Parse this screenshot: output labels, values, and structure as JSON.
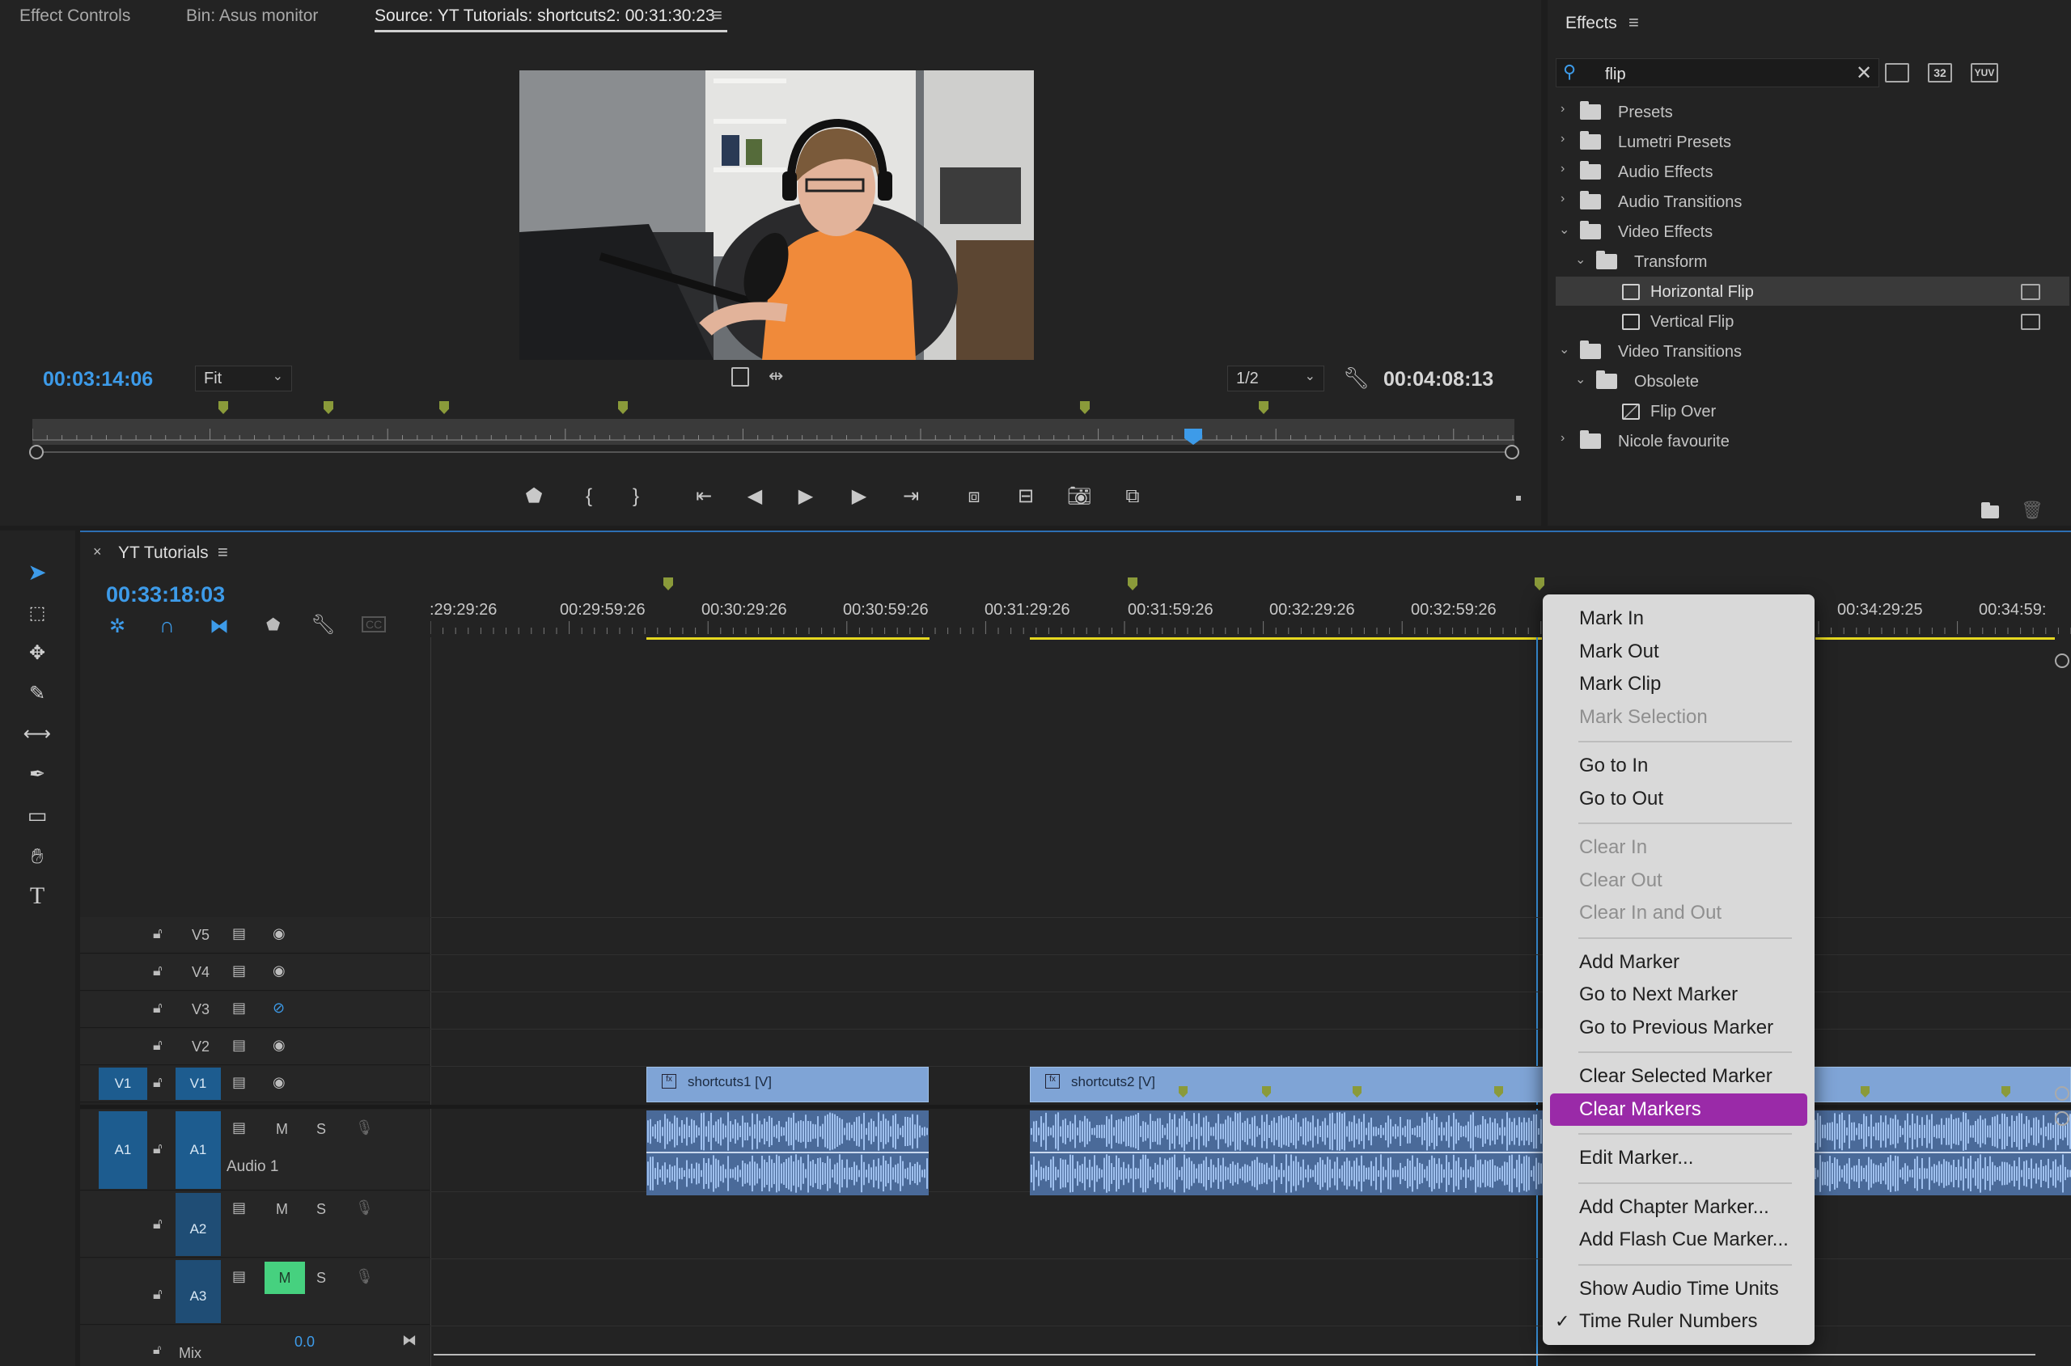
{
  "source_panel": {
    "tabs": [
      "Effect Controls",
      "Bin: Asus monitor",
      "Source: YT Tutorials: shortcuts2: 00:31:30:23"
    ],
    "current_time": "00:03:14:06",
    "zoom": "Fit",
    "resolution": "1/2",
    "duration": "00:04:08:13"
  },
  "effects_panel": {
    "title": "Effects",
    "search": {
      "value": "flip"
    },
    "view_buttons": [
      "32"
    ],
    "tree": [
      {
        "label": "Presets",
        "indent": 0,
        "type": "folder",
        "expanded": false
      },
      {
        "label": "Lumetri Presets",
        "indent": 0,
        "type": "folder",
        "expanded": false
      },
      {
        "label": "Audio Effects",
        "indent": 0,
        "type": "folder",
        "expanded": false
      },
      {
        "label": "Audio Transitions",
        "indent": 0,
        "type": "folder",
        "expanded": false
      },
      {
        "label": "Video Effects",
        "indent": 0,
        "type": "folder",
        "expanded": true
      },
      {
        "label": "Transform",
        "indent": 1,
        "type": "folder",
        "expanded": true
      },
      {
        "label": "Horizontal Flip",
        "indent": 2,
        "type": "effect",
        "selected": true
      },
      {
        "label": "Vertical Flip",
        "indent": 2,
        "type": "effect"
      },
      {
        "label": "Video Transitions",
        "indent": 0,
        "type": "folder",
        "expanded": true
      },
      {
        "label": "Obsolete",
        "indent": 1,
        "type": "folder",
        "expanded": true
      },
      {
        "label": "Flip Over",
        "indent": 2,
        "type": "transition"
      },
      {
        "label": "Nicole favourite",
        "indent": 0,
        "type": "folder",
        "expanded": false
      }
    ]
  },
  "timeline": {
    "sequence_name": "YT Tutorials",
    "close": "×",
    "current_time": "00:33:18:03",
    "ruler_labels": [
      ":29:29:26",
      "00:29:59:26",
      "00:30:29:26",
      "00:30:59:26",
      "00:31:29:26",
      "00:31:59:26",
      "00:32:29:26",
      "00:32:59:26",
      "00:34:29:25",
      "00:34:59:"
    ],
    "tracks": {
      "video": [
        "V5",
        "V4",
        "V3",
        "V2",
        "V1"
      ],
      "audio": [
        "A1",
        "A2",
        "A3"
      ],
      "source_v": "V1",
      "source_a": "A1",
      "audio1_name": "Audio 1",
      "mute": "M",
      "solo": "S",
      "mix_label": "Mix",
      "mix_value": "0.0"
    },
    "clips": [
      {
        "name": "shortcuts1 [V]"
      },
      {
        "name": "shortcuts2 [V]"
      }
    ]
  },
  "context_menu": {
    "groups": [
      [
        {
          "label": "Mark In"
        },
        {
          "label": "Mark Out"
        },
        {
          "label": "Mark Clip"
        },
        {
          "label": "Mark Selection",
          "disabled": true
        }
      ],
      [
        {
          "label": "Go to In"
        },
        {
          "label": "Go to Out"
        }
      ],
      [
        {
          "label": "Clear In",
          "disabled": true
        },
        {
          "label": "Clear Out",
          "disabled": true
        },
        {
          "label": "Clear In and Out",
          "disabled": true
        }
      ],
      [
        {
          "label": "Add Marker"
        },
        {
          "label": "Go to Next Marker"
        },
        {
          "label": "Go to Previous Marker"
        }
      ],
      [
        {
          "label": "Clear Selected Marker"
        },
        {
          "label": "Clear Markers",
          "highlighted": true
        }
      ],
      [
        {
          "label": "Edit Marker..."
        }
      ],
      [
        {
          "label": "Add Chapter Marker..."
        },
        {
          "label": "Add Flash Cue Marker..."
        }
      ],
      [
        {
          "label": "Show Audio Time Units"
        },
        {
          "label": "Time Ruler Numbers",
          "checked": true
        }
      ]
    ],
    "check_glyph": "✓"
  },
  "colors": {
    "accent_blue": "#3d9be9",
    "menu_highlight": "#9a2aa8",
    "marker_green": "#8a9a3a",
    "clip_video": "#7fa4d6",
    "clip_audio": "#4a6a99",
    "mute_active": "#46d17f"
  }
}
